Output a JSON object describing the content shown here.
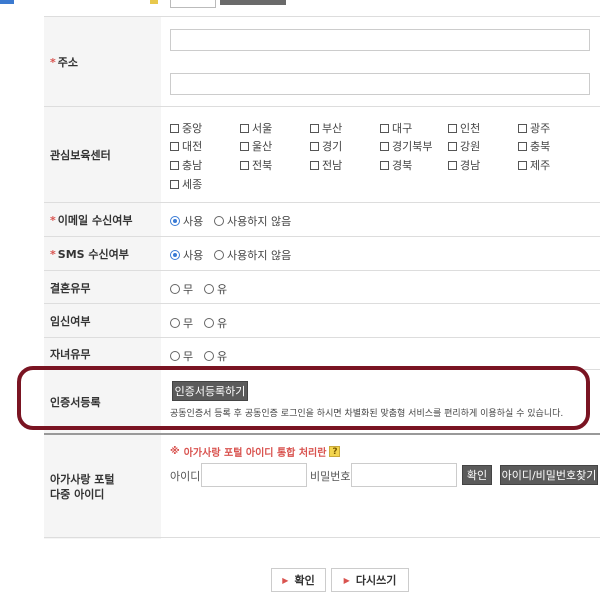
{
  "header_strip": {},
  "address": {
    "label": "주소",
    "required": "*"
  },
  "centers": {
    "label": "관심보육센터",
    "items": [
      "중앙",
      "서울",
      "부산",
      "대구",
      "인천",
      "광주",
      "대전",
      "울산",
      "경기",
      "경기북부",
      "강원",
      "충북",
      "충남",
      "전북",
      "전남",
      "경북",
      "경남",
      "제주",
      "세종"
    ]
  },
  "email": {
    "label": "이메일 수신여부",
    "required": "*",
    "options": [
      "사용",
      "사용하지 않음"
    ],
    "selected": "사용"
  },
  "sms": {
    "label": "SMS 수신여부",
    "required": "*",
    "options": [
      "사용",
      "사용하지 않음"
    ],
    "selected": "사용"
  },
  "marriage": {
    "label": "결혼유무",
    "options": [
      "무",
      "유"
    ]
  },
  "pregnancy": {
    "label": "임신여부",
    "options": [
      "무",
      "유"
    ]
  },
  "children": {
    "label": "자녀유무",
    "options": [
      "무",
      "유"
    ]
  },
  "certificate": {
    "label": "인증서등록",
    "button": "인증서등록하기",
    "description": "공동인증서 등록 후 공동인증 로그인을 하시면 차별화된 맞춤형 서비스를 편리하게 이용하실 수 있습니다."
  },
  "portal": {
    "label_line1": "아가사랑 포털",
    "label_line2": "다중 아이디",
    "notice_mark": "※",
    "notice": "아가사랑 포털 아이디 통합 처리란",
    "help": "?",
    "id_label": "아이디",
    "pw_label": "비밀번호",
    "confirm_button": "확인",
    "find_button": "아이디/비밀번호찾기"
  },
  "footer": {
    "confirm": "확인",
    "rewrite": "다시쓰기"
  }
}
